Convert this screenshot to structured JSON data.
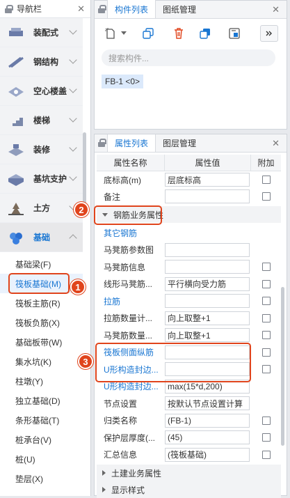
{
  "nav": {
    "title": "导航栏",
    "categories": [
      {
        "label": "装配式",
        "icon": "assembly-icon"
      },
      {
        "label": "钢结构",
        "icon": "steel-structure-icon"
      },
      {
        "label": "空心楼盖",
        "icon": "hollow-floor-icon"
      },
      {
        "label": "楼梯",
        "icon": "stairs-icon"
      },
      {
        "label": "装修",
        "icon": "decoration-icon"
      },
      {
        "label": "基坑支护",
        "icon": "foundation-pit-icon"
      },
      {
        "label": "土方",
        "icon": "earthwork-icon"
      },
      {
        "label": "基础",
        "icon": "foundation-icon"
      }
    ],
    "items": [
      "基础梁(F)",
      "筏板基础(M)",
      "筏板主筋(R)",
      "筏板负筋(X)",
      "基础板带(W)",
      "集水坑(K)",
      "柱墩(Y)",
      "独立基础(D)",
      "条形基础(T)",
      "桩承台(V)",
      "桩(U)",
      "垫层(X)"
    ]
  },
  "component_panel": {
    "tabs": [
      "构件列表",
      "图纸管理"
    ],
    "search_placeholder": "搜索构件...",
    "item": "FB-1 <0>"
  },
  "property_panel": {
    "tabs": [
      "属性列表",
      "图层管理"
    ],
    "headers": [
      "属性名称",
      "属性值",
      "附加"
    ],
    "rows_top": [
      {
        "name": "底标高(m)",
        "value": "层底标高",
        "check": true
      },
      {
        "name": "备注",
        "value": "",
        "check": true
      }
    ],
    "group_rebar": "钢筋业务属性",
    "rows_rebar": [
      {
        "name": "其它钢筋",
        "value": "",
        "blue": true,
        "nob": true,
        "check": false
      },
      {
        "name": "马凳筋参数图",
        "value": "",
        "blue": false,
        "check": false
      },
      {
        "name": "马凳筋信息",
        "value": "",
        "blue": false,
        "check": true
      },
      {
        "name": "线形马凳筋...",
        "value": "平行横向受力筋",
        "blue": false,
        "check": true
      },
      {
        "name": "拉筋",
        "value": "",
        "blue": true,
        "check": true
      },
      {
        "name": "拉筋数量计...",
        "value": "向上取整+1",
        "blue": false,
        "check": true
      },
      {
        "name": "马凳筋数量...",
        "value": "向上取整+1",
        "blue": false,
        "check": true
      },
      {
        "name": "筏板侧面纵筋",
        "value": "",
        "blue": true,
        "check": true
      },
      {
        "name": "U形构造封边...",
        "value": "",
        "blue": true,
        "check": true
      },
      {
        "name": "U形构造封边...",
        "value": "max(15*d,200)",
        "blue": true,
        "check": false
      },
      {
        "name": "节点设置",
        "value": "按默认节点设置计算",
        "blue": false,
        "check": false
      },
      {
        "name": "归类名称",
        "value": "(FB-1)",
        "blue": false,
        "check": true
      },
      {
        "name": "保护层厚度(...",
        "value": "(45)",
        "blue": false,
        "check": true
      },
      {
        "name": "汇总信息",
        "value": "(筏板基础)",
        "blue": false,
        "check": true
      }
    ],
    "group_civil": "土建业务属性",
    "group_display": "显示样式"
  },
  "badges": [
    "1",
    "2",
    "3"
  ],
  "colors": {
    "accent": "#1976d2",
    "annotation": "#e0441c"
  }
}
